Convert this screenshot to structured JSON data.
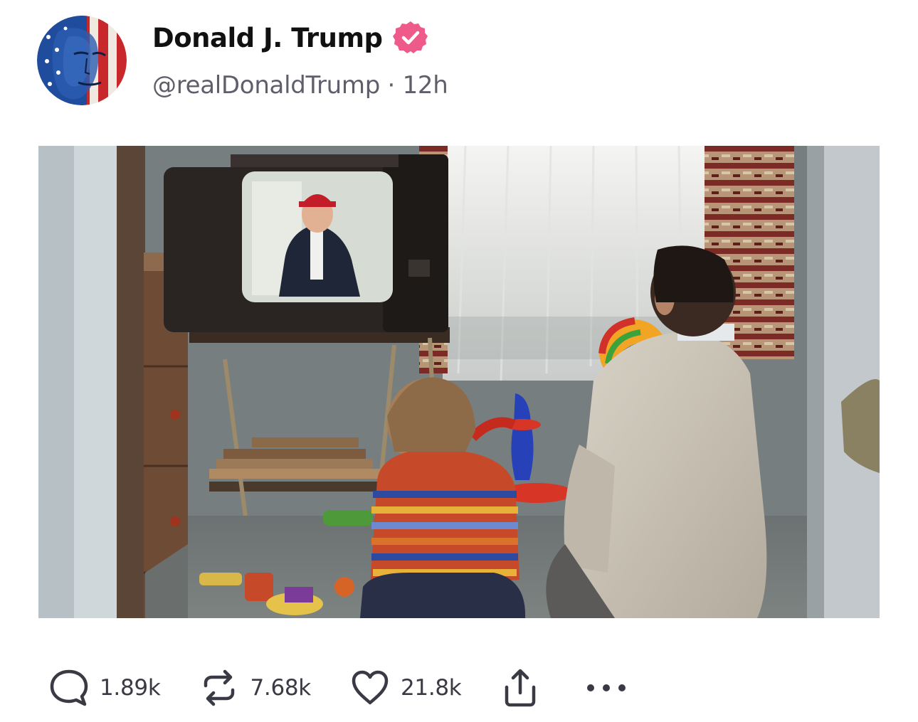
{
  "author": {
    "display_name": "Donald J. Trump",
    "handle": "@realDonaldTrump",
    "separator": "·",
    "time_ago": "12h",
    "verified_color": "#ee5a8a"
  },
  "media": {
    "icon": "image-thumbnail"
  },
  "actions": {
    "replies": "1.89k",
    "reposts": "7.68k",
    "likes": "21.8k",
    "icons": [
      "comment-icon",
      "repost-icon",
      "heart-icon",
      "share-icon",
      "more-icon"
    ]
  }
}
